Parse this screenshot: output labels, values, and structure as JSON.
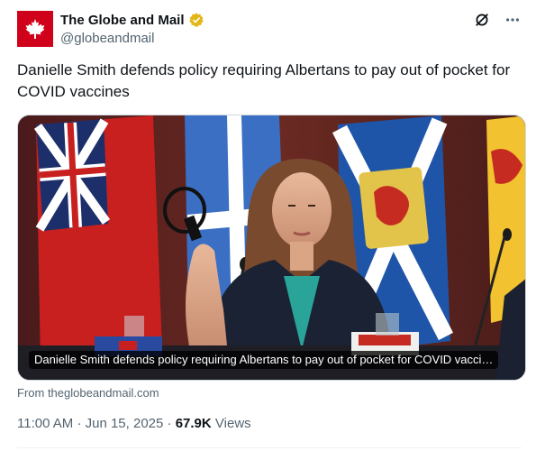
{
  "author": {
    "name": "The Globe and Mail",
    "handle": "@globeandmail",
    "verified_color": "#e2b719",
    "avatar_color": "#d0021b"
  },
  "actions": {
    "grok_icon": "grok-icon",
    "more_icon": "more-icon"
  },
  "tweet": {
    "text": "Danielle Smith defends policy requiring Albertans to pay out of pocket for COVID vaccines"
  },
  "card": {
    "caption": "Danielle Smith defends policy requiring Albertans to pay out of pocket for COVID vacci…",
    "source": "From theglobeandmail.com"
  },
  "meta": {
    "time": "11:00 AM",
    "separator": "·",
    "date": "Jun 15, 2025",
    "views_count": "67.9K",
    "views_label": "Views"
  }
}
